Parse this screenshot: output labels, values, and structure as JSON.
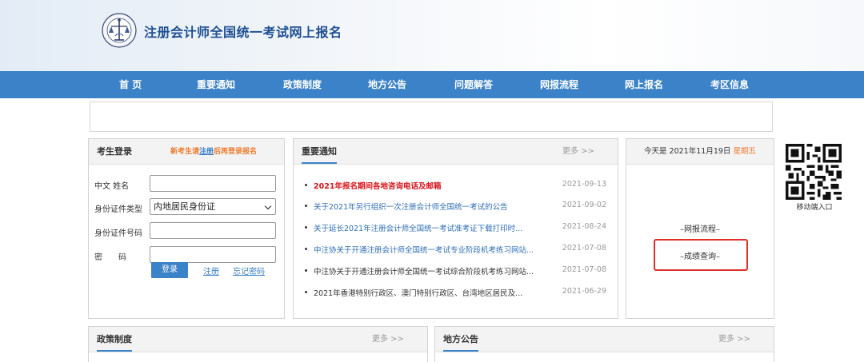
{
  "header": {
    "site_title": "注册会计师全国统一考试网上报名",
    "logo_icon": "cicpa-emblem-icon"
  },
  "nav": {
    "items": [
      "首 页",
      "重要通知",
      "政策制度",
      "地方公告",
      "问题解答",
      "网报流程",
      "网上报名",
      "考区信息"
    ]
  },
  "login": {
    "title": "考生登录",
    "hint_prefix": "新考生请",
    "hint_link": "注册",
    "hint_suffix": "后再登录报名",
    "name_label": "中文 姓名",
    "idtype_label": "身份证件类型",
    "idtype_value": "内地居民身份证",
    "idno_label": "身份证件号码",
    "password_label": "密　　码",
    "login_button": "登录",
    "register_link": "注册",
    "forgot_link": "忘记密码"
  },
  "notices": {
    "title": "重要通知",
    "more": "更多 >>",
    "items": [
      {
        "text": "2021年报名期间各地咨询电话及邮箱",
        "date": "2021-09-13",
        "color": "#d8141a",
        "bold": true
      },
      {
        "text": "关于2021年另行组织一次注册会计师全国统一考试的公告",
        "date": "2021-09-02",
        "color": "#2f6fb7",
        "bold": false
      },
      {
        "text": "关于延长2021年注册会计师全国统一考试准考证下载打印时...",
        "date": "2021-08-24",
        "color": "#2f6fb7",
        "bold": false
      },
      {
        "text": "中注协关于开通注册会计师全国统一考试专业阶段机考练习网站...",
        "date": "2021-07-08",
        "color": "#2f6fb7",
        "bold": false
      },
      {
        "text": "中注协关于开通注册会计师全国统一考试综合阶段机考练习网站...",
        "date": "2021-07-08",
        "color": "#333333",
        "bold": false
      },
      {
        "text": "2021年香港特别行政区、澳门特别行政区、台湾地区居民及...",
        "date": "2021-06-29",
        "color": "#333333",
        "bold": false
      }
    ]
  },
  "side": {
    "today_prefix": "今天是 2021年11月19日",
    "weekday": "星期五",
    "links": [
      "–网报流程–",
      "–成绩查询–"
    ]
  },
  "qr": {
    "label": "移动端入口"
  },
  "policy": {
    "title": "政策制度",
    "more": "更多 >>"
  },
  "local": {
    "title": "地方公告",
    "more": "更多 >>"
  },
  "colors": {
    "nav_bg": "#3b82c8",
    "accent_orange": "#ef7c2d",
    "alert_red": "#d8141a",
    "highlight_red": "#e0302a"
  }
}
